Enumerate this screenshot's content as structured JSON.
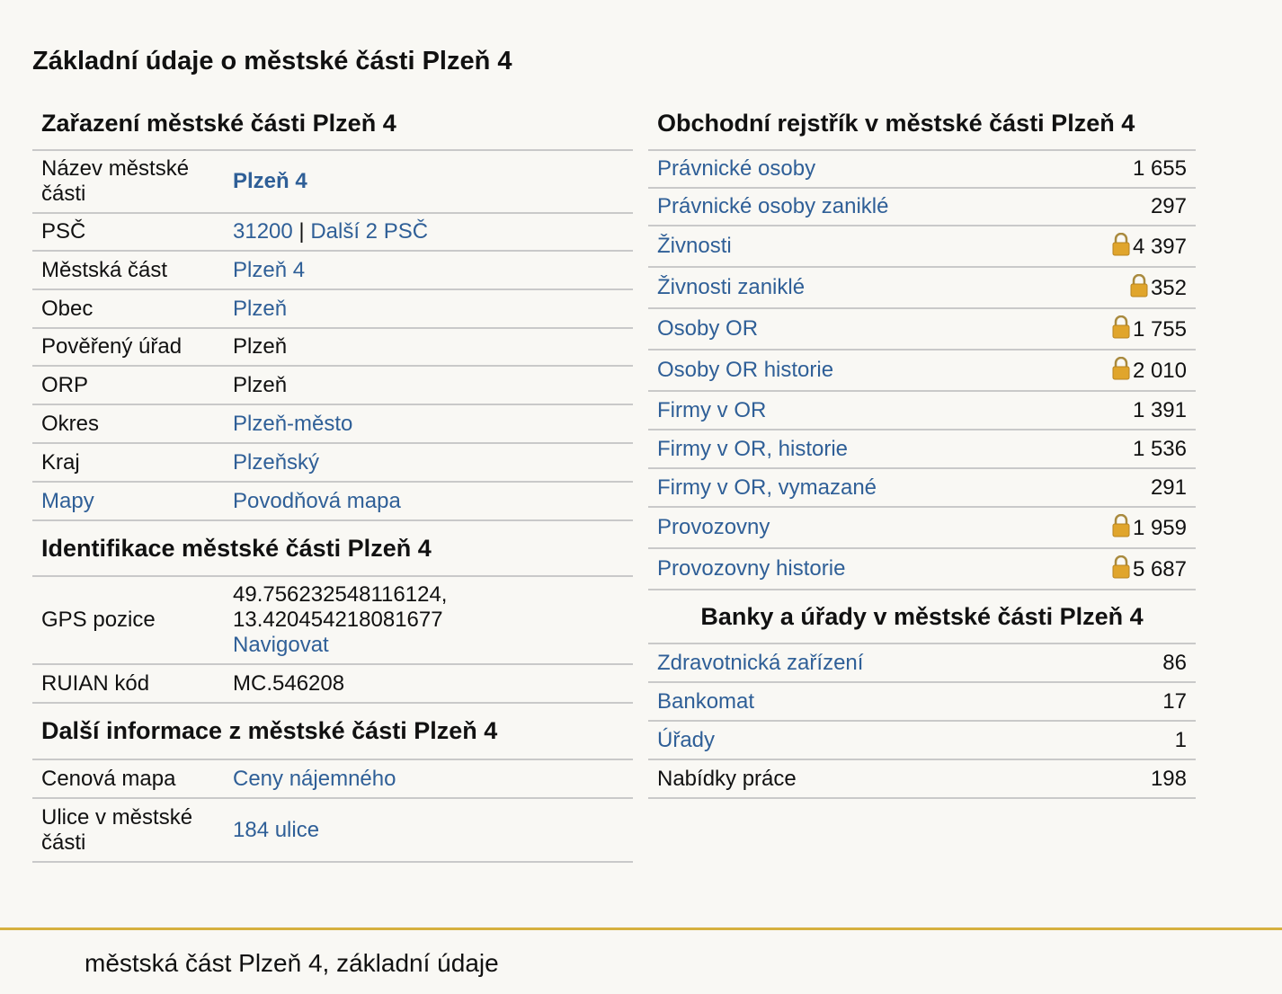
{
  "page_title": "Základní údaje o městské části Plzeň 4",
  "zarazeni": {
    "title": "Zařazení městské části Plzeň 4",
    "rows": [
      {
        "label": "Název městské části",
        "value": "Plzeň 4"
      },
      {
        "label": "PSČ",
        "psc": "31200",
        "separator": "|",
        "dalsi": "Další 2 PSČ"
      },
      {
        "label": "Městská část",
        "value": "Plzeň 4"
      },
      {
        "label": "Obec",
        "value": "Plzeň"
      },
      {
        "label": "Pověřený úřad",
        "value": "Plzeň"
      },
      {
        "label": "ORP",
        "value": "Plzeň"
      },
      {
        "label": "Okres",
        "value": "Plzeň-město"
      },
      {
        "label": "Kraj",
        "value": "Plzeňský"
      },
      {
        "label": "Mapy",
        "value": "Povodňová mapa"
      }
    ]
  },
  "identifikace": {
    "title": "Identifikace městské části Plzeň 4",
    "gps": {
      "label": "GPS pozice",
      "lat": "49.756232548116124,",
      "lon": "13.420454218081677",
      "navigate": "Navigovat"
    },
    "ruian": {
      "label": "RUIAN kód",
      "value": "MC.546208"
    }
  },
  "dalsi": {
    "title": "Další informace z městské části Plzeň 4",
    "rows": [
      {
        "label": "Cenová mapa",
        "value": "Ceny nájemného"
      },
      {
        "label": "Ulice v městské části",
        "value": "184 ulice"
      }
    ]
  },
  "obchodni": {
    "title": "Obchodní rejstřík v městské části Plzeň 4",
    "rows": [
      {
        "label": "Právnické osoby",
        "value": "1 655",
        "locked": false
      },
      {
        "label": "Právnické osoby zaniklé",
        "value": "297",
        "locked": false
      },
      {
        "label": "Živnosti",
        "value": "4 397",
        "locked": true
      },
      {
        "label": "Živnosti zaniklé",
        "value": "352",
        "locked": true
      },
      {
        "label": "Osoby OR",
        "value": "1 755",
        "locked": true
      },
      {
        "label": "Osoby OR historie",
        "value": "2 010",
        "locked": true
      },
      {
        "label": "Firmy v OR",
        "value": "1 391",
        "locked": false
      },
      {
        "label": "Firmy v OR, historie",
        "value": "1 536",
        "locked": false
      },
      {
        "label": "Firmy v OR, vymazané",
        "value": "291",
        "locked": false
      },
      {
        "label": "Provozovny",
        "value": "1 959",
        "locked": true
      },
      {
        "label": "Provozovny historie",
        "value": "5 687",
        "locked": true
      }
    ]
  },
  "banky": {
    "title": "Banky a úřady v městské části Plzeň 4",
    "rows": [
      {
        "label": "Zdravotnická zařízení",
        "value": "86"
      },
      {
        "label": "Bankomat",
        "value": "17"
      },
      {
        "label": "Úřady",
        "value": "1"
      },
      {
        "label": "Nabídky práce",
        "value": "198"
      }
    ]
  },
  "footer": "městská část Plzeň 4, základní údaje",
  "colors": {
    "link": "#2f5f97",
    "accent_line": "#d6b03e",
    "background": "#f9f8f4",
    "lock": "#e0a52c"
  }
}
